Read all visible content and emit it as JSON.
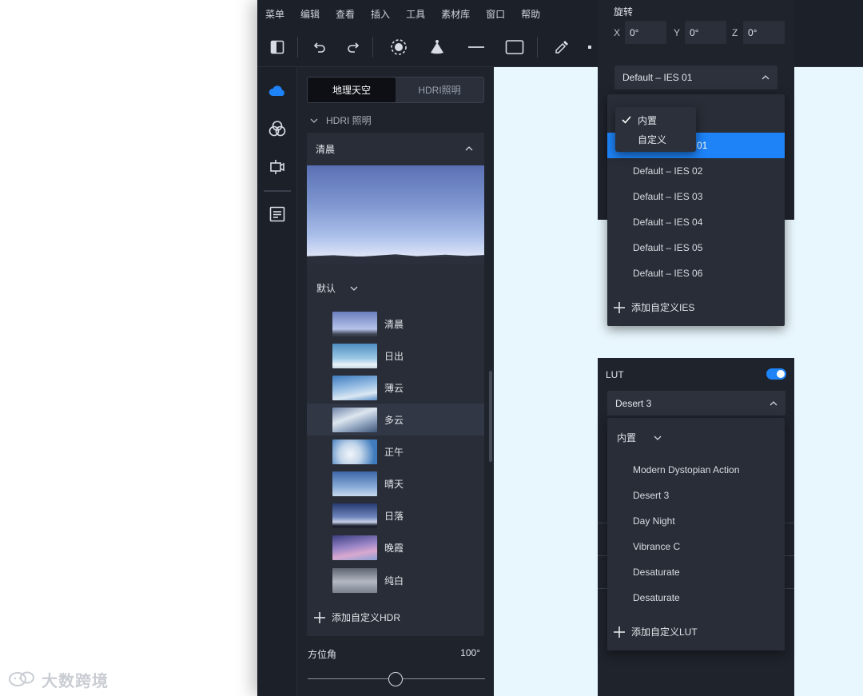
{
  "menu": [
    "菜单",
    "编辑",
    "查看",
    "插入",
    "工具",
    "素材库",
    "窗口",
    "帮助"
  ],
  "panel": {
    "tabs": [
      "地理天空",
      "HDRI照明"
    ],
    "section": "HDRI 照明",
    "card_title": "清晨",
    "filter": "默认",
    "items": [
      "清晨",
      "日出",
      "薄云",
      "多云",
      "正午",
      "晴天",
      "日落",
      "晚霞",
      "纯白"
    ],
    "add_label": "添加自定义HDR",
    "azimuth_label": "方位角",
    "azimuth_value": "100°",
    "azimuth_fraction": 0.5
  },
  "rotation": {
    "title": "旋转",
    "x_label": "X",
    "x_value": "0°",
    "y_label": "Y",
    "y_value": "0°",
    "z_label": "Z",
    "z_value": "0°"
  },
  "ies": {
    "selected": "Default – IES 01",
    "mini_options": [
      "内置",
      "自定义"
    ],
    "highlight_suffix": "01",
    "options": [
      "Default – IES 02",
      "Default – IES 03",
      "Default – IES 04",
      "Default – IES 05",
      "Default – IES 06"
    ],
    "add_label": "添加自定义IES"
  },
  "lut": {
    "title": "LUT",
    "enabled": true,
    "selected": "Desert 3",
    "filter": "内置",
    "options": [
      "Modern Dystopian Action",
      "Desert 3",
      "Day Night",
      "Vibrance C",
      "Desaturate",
      "Desaturate"
    ],
    "add_label": "添加自定义LUT"
  },
  "watermark": "大数跨境",
  "colors": {
    "accent": "#1d83f7",
    "panel_bg": "#1f232c",
    "canvas_bg": "#e8f6fd"
  }
}
